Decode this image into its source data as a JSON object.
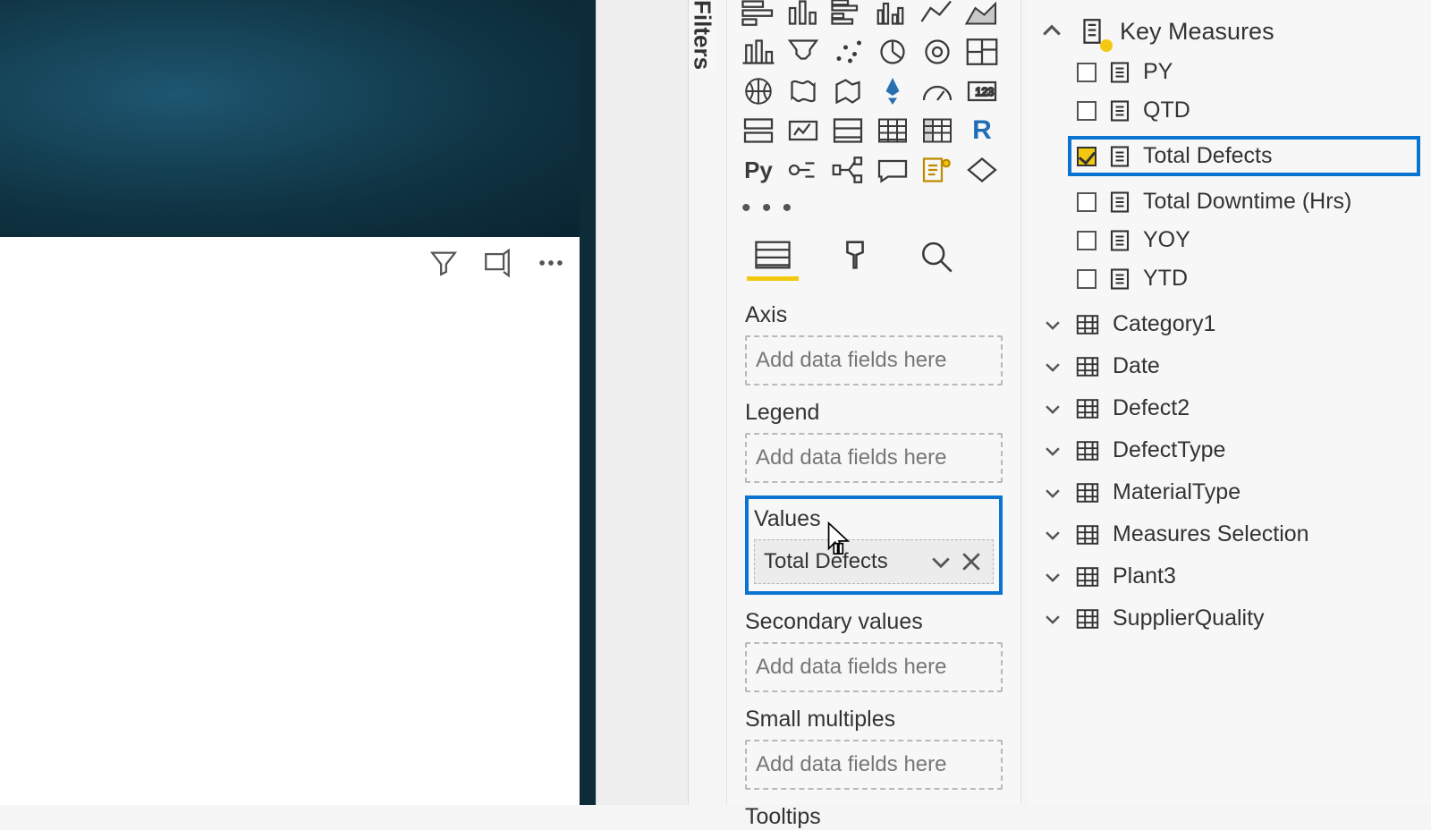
{
  "filters_label": "Filters",
  "mode_tabs": {
    "fields": "fields",
    "format": "format",
    "analytics": "analytics"
  },
  "wells": {
    "axis": {
      "label": "Axis",
      "placeholder": "Add data fields here"
    },
    "legend": {
      "label": "Legend",
      "placeholder": "Add data fields here"
    },
    "values": {
      "label": "Values",
      "pill": "Total Defects"
    },
    "secondary": {
      "label": "Secondary values",
      "placeholder": "Add data fields here"
    },
    "small_multiples": {
      "label": "Small multiples",
      "placeholder": "Add data fields here"
    },
    "tooltips": {
      "label": "Tooltips"
    }
  },
  "dots": "• • •",
  "fields": {
    "header": "Key Measures",
    "measures": [
      {
        "name": "PY",
        "checked": false
      },
      {
        "name": "QTD",
        "checked": false
      },
      {
        "name": "Total Defects",
        "checked": true,
        "highlight": true
      },
      {
        "name": "Total Downtime (Hrs)",
        "checked": false
      },
      {
        "name": "YOY",
        "checked": false
      },
      {
        "name": "YTD",
        "checked": false
      }
    ],
    "tables": [
      "Category1",
      "Date",
      "Defect2",
      "DefectType",
      "MaterialType",
      "Measures Selection",
      "Plant3",
      "SupplierQuality"
    ]
  },
  "viz_icons": [
    "stacked-bar",
    "stacked-column",
    "clustered-bar",
    "clustered-column",
    "100-stacked-bar",
    "100-stacked-column",
    "column",
    "funnel",
    "scatter",
    "pie",
    "donut",
    "treemap",
    "globe",
    "filled-map",
    "shape-map",
    "azure-map",
    "gauge",
    "card",
    "multi-row-card",
    "kpi",
    "slicer",
    "table",
    "matrix",
    "r-visual",
    "python-visual",
    "key-influencers",
    "decomposition-tree",
    "qna",
    "smart-narrative",
    "paginated"
  ]
}
